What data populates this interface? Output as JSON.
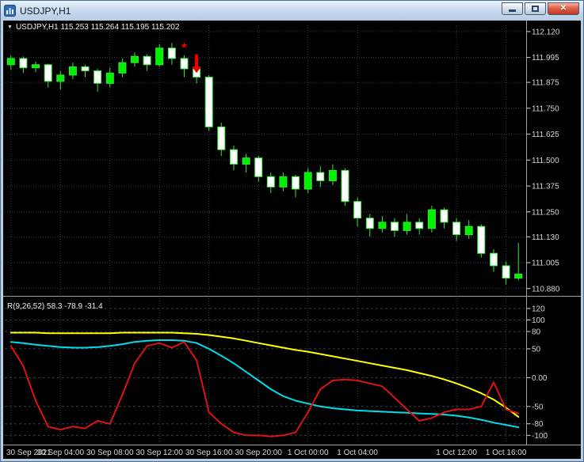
{
  "window": {
    "title": "USDJPY,H1",
    "close_glyph": "✕"
  },
  "colors": {
    "background": "#000000",
    "grid": "#2e3e48",
    "separator": "#98a0a8",
    "axis_text": "#d6d6d6",
    "candle_stroke": "#33e833",
    "bull_fill": "#00f000",
    "bear_fill": "#ffffff",
    "annotation_red": "#e60000"
  },
  "main_chart": {
    "collapse_arrow": "▼",
    "ohlc_label": "USDJPY,H1 115.253 115.264 115.195 115.202",
    "price_axis_labels": [
      "112.120",
      "111.995",
      "111.875",
      "111.750",
      "111.625",
      "111.500",
      "111.375",
      "111.250",
      "111.130",
      "111.005",
      "110.880"
    ]
  },
  "indicator_pane": {
    "label": "R(9,26,52) 58.3 -78.9 -31.4",
    "axis_labels": [
      "120",
      "100",
      "80",
      "50",
      "0.00",
      "-50",
      "-80",
      "-100"
    ]
  },
  "time_axis": {
    "labels": [
      {
        "text": "30 Sep 2021",
        "i": 0
      },
      {
        "text": "30 Sep 04:00",
        "i": 4
      },
      {
        "text": "30 Sep 08:00",
        "i": 8
      },
      {
        "text": "30 Sep 12:00",
        "i": 12
      },
      {
        "text": "30 Sep 16:00",
        "i": 16
      },
      {
        "text": "30 Sep 20:00",
        "i": 20
      },
      {
        "text": "1 Oct 00:00",
        "i": 24
      },
      {
        "text": "1 Oct 04:00",
        "i": 28
      },
      {
        "text": "1 Oct 12:00",
        "i": 36
      },
      {
        "text": "1 Oct 16:00",
        "i": 40
      }
    ]
  },
  "chart_data": {
    "type": "candlestick",
    "symbol": "USDJPY",
    "timeframe": "H1",
    "price_range": [
      110.86,
      112.15
    ],
    "candles_columns": [
      "open",
      "high",
      "low",
      "close"
    ],
    "candles": [
      [
        111.96,
        112.005,
        111.935,
        111.99
      ],
      [
        111.99,
        112.0,
        111.92,
        111.945
      ],
      [
        111.945,
        111.975,
        111.925,
        111.96
      ],
      [
        111.96,
        111.965,
        111.85,
        111.88
      ],
      [
        111.88,
        111.93,
        111.84,
        111.91
      ],
      [
        111.91,
        111.97,
        111.89,
        111.95
      ],
      [
        111.95,
        111.96,
        111.9,
        111.93
      ],
      [
        111.93,
        111.94,
        111.83,
        111.87
      ],
      [
        111.87,
        111.945,
        111.85,
        111.92
      ],
      [
        111.92,
        111.99,
        111.9,
        111.97
      ],
      [
        111.97,
        112.02,
        111.95,
        112.0
      ],
      [
        112.0,
        112.01,
        111.93,
        111.96
      ],
      [
        111.96,
        112.06,
        111.95,
        112.04
      ],
      [
        112.04,
        112.065,
        111.96,
        111.99
      ],
      [
        111.99,
        112.005,
        111.9,
        111.94
      ],
      [
        111.94,
        111.96,
        111.87,
        111.9
      ],
      [
        111.9,
        111.91,
        111.64,
        111.66
      ],
      [
        111.66,
        111.68,
        111.52,
        111.55
      ],
      [
        111.55,
        111.57,
        111.45,
        111.48
      ],
      [
        111.48,
        111.53,
        111.44,
        111.51
      ],
      [
        111.51,
        111.52,
        111.395,
        111.42
      ],
      [
        111.42,
        111.44,
        111.34,
        111.37
      ],
      [
        111.37,
        111.44,
        111.35,
        111.42
      ],
      [
        111.42,
        111.43,
        111.32,
        111.36
      ],
      [
        111.36,
        111.46,
        111.34,
        111.44
      ],
      [
        111.44,
        111.47,
        111.37,
        111.4
      ],
      [
        111.4,
        111.48,
        111.38,
        111.45
      ],
      [
        111.45,
        111.46,
        111.28,
        111.3
      ],
      [
        111.3,
        111.32,
        111.18,
        111.22
      ],
      [
        111.22,
        111.24,
        111.13,
        111.17
      ],
      [
        111.17,
        111.23,
        111.15,
        111.2
      ],
      [
        111.2,
        111.22,
        111.13,
        111.16
      ],
      [
        111.16,
        111.24,
        111.14,
        111.2
      ],
      [
        111.2,
        111.22,
        111.14,
        111.17
      ],
      [
        111.17,
        111.28,
        111.15,
        111.26
      ],
      [
        111.26,
        111.27,
        111.17,
        111.2
      ],
      [
        111.2,
        111.22,
        111.11,
        111.14
      ],
      [
        111.14,
        111.21,
        111.12,
        111.18
      ],
      [
        111.18,
        111.19,
        111.03,
        111.05
      ],
      [
        111.05,
        111.07,
        110.96,
        110.99
      ],
      [
        110.99,
        111.01,
        110.9,
        110.93
      ],
      [
        110.93,
        111.1,
        110.92,
        110.95
      ]
    ],
    "annotations": [
      {
        "type": "star",
        "glyph": "★",
        "index": 14,
        "price": 112.04
      },
      {
        "type": "down-arrow",
        "index": 15,
        "price_top": 112.01,
        "price_bottom": 111.92
      }
    ],
    "oscillator": {
      "range": [
        -112,
        135
      ],
      "series": [
        {
          "name": "slow-line",
          "color": "#ffff00",
          "values": [
            78,
            78,
            78,
            77,
            77,
            77,
            77,
            77,
            77,
            78,
            78,
            78,
            78,
            78,
            77,
            76,
            74,
            71,
            68,
            64,
            60,
            56,
            52,
            48,
            45,
            41,
            37,
            33,
            29,
            25,
            21,
            17,
            13,
            8,
            3,
            -3,
            -10,
            -18,
            -27,
            -38,
            -52,
            -68
          ]
        },
        {
          "name": "mid-line",
          "color": "#00dce8",
          "values": [
            62,
            60,
            57,
            55,
            53,
            52,
            52,
            53,
            55,
            58,
            62,
            64,
            65,
            65,
            64,
            60,
            50,
            38,
            25,
            10,
            -5,
            -20,
            -32,
            -40,
            -45,
            -50,
            -53,
            -55,
            -57,
            -58,
            -59,
            -60,
            -61,
            -62,
            -63,
            -64,
            -66,
            -69,
            -73,
            -78,
            -82,
            -86
          ]
        },
        {
          "name": "fast-line",
          "color": "#dd1212",
          "values": [
            55,
            20,
            -40,
            -85,
            -90,
            -85,
            -88,
            -75,
            -80,
            -30,
            25,
            55,
            60,
            52,
            62,
            30,
            -60,
            -80,
            -95,
            -100,
            -100,
            -102,
            -100,
            -95,
            -60,
            -20,
            -5,
            -3,
            -5,
            -10,
            -15,
            -35,
            -55,
            -75,
            -70,
            -60,
            -55,
            -55,
            -50,
            -8,
            -55,
            -62
          ]
        }
      ]
    }
  }
}
